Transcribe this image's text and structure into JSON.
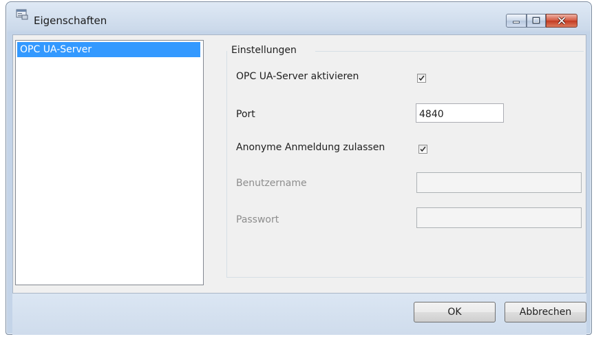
{
  "window": {
    "title": "Eigenschaften"
  },
  "sidebar": {
    "items": [
      {
        "label": "OPC UA-Server",
        "selected": true
      }
    ]
  },
  "group": {
    "title": "Einstellungen"
  },
  "settings": {
    "activate_label": "OPC UA-Server aktivieren",
    "activate_checked": true,
    "port_label": "Port",
    "port_value": "4840",
    "anonymous_label": "Anonyme Anmeldung zulassen",
    "anonymous_checked": true,
    "username_label": "Benutzername",
    "username_value": "",
    "password_label": "Passwort",
    "password_value": ""
  },
  "buttons": {
    "ok": "OK",
    "cancel": "Abbrechen"
  },
  "colors": {
    "selection": "#3399ff",
    "close_button": "#c23a22",
    "disabled_text": "#8d8d8d"
  },
  "icons": {
    "app": "properties-window-icon",
    "minimize": "minimize-icon",
    "maximize": "maximize-icon",
    "close": "close-icon",
    "check": "checkmark-icon"
  }
}
